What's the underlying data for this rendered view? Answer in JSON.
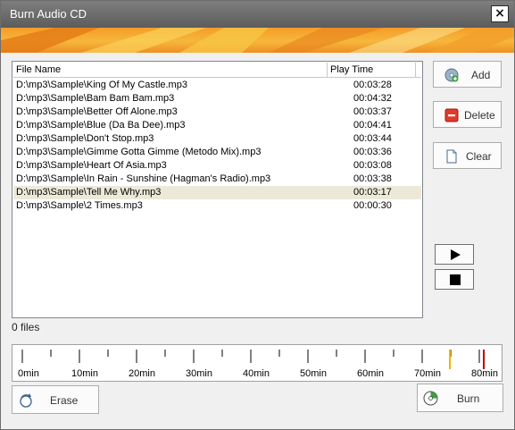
{
  "window": {
    "title": "Burn Audio CD"
  },
  "close_label": "×",
  "list": {
    "columns": [
      "File Name",
      "Play Time"
    ],
    "rows": [
      {
        "file": "D:\\mp3\\Sample\\King Of My Castle.mp3",
        "time": "00:03:28"
      },
      {
        "file": "D:\\mp3\\Sample\\Bam Bam Bam.mp3",
        "time": "00:04:32"
      },
      {
        "file": "D:\\mp3\\Sample\\Better Off Alone.mp3",
        "time": "00:03:37"
      },
      {
        "file": "D:\\mp3\\Sample\\Blue (Da Ba Dee).mp3",
        "time": "00:04:41"
      },
      {
        "file": "D:\\mp3\\Sample\\Don't Stop.mp3",
        "time": "00:03:44"
      },
      {
        "file": "D:\\mp3\\Sample\\Gimme Gotta Gimme (Metodo Mix).mp3",
        "time": "00:03:36"
      },
      {
        "file": "D:\\mp3\\Sample\\Heart Of Asia.mp3",
        "time": "00:03:08"
      },
      {
        "file": "D:\\mp3\\Sample\\In Rain - Sunshine (Hagman's Radio).mp3",
        "time": "00:03:38"
      },
      {
        "file": "D:\\mp3\\Sample\\Tell Me Why.mp3",
        "time": "00:03:17"
      },
      {
        "file": "D:\\mp3\\Sample\\2 Times.mp3",
        "time": "00:00:30"
      }
    ],
    "selected_index": 8
  },
  "buttons": {
    "add": "Add",
    "delete": "Delete",
    "clear": "Clear",
    "erase": "Erase",
    "burn": "Burn"
  },
  "status": {
    "file_count": "0 files"
  },
  "ruler": {
    "labels": [
      "0min",
      "10min",
      "20min",
      "30min",
      "40min",
      "50min",
      "60min",
      "70min",
      "80min"
    ],
    "markers": [
      {
        "name": "warning-marker",
        "minutes": 74,
        "color": "#f0b400"
      },
      {
        "name": "limit-marker",
        "minutes": 80,
        "color": "#c00000"
      }
    ]
  },
  "colors": {
    "selected_row": "#ece9d8",
    "banner": "#f5a632"
  },
  "icons": {
    "add": "cd-add-icon",
    "delete": "delete-icon",
    "clear": "clear-document-icon",
    "play": "play-icon",
    "stop": "stop-icon",
    "erase": "erase-disc-icon",
    "burn": "burn-disc-icon"
  }
}
